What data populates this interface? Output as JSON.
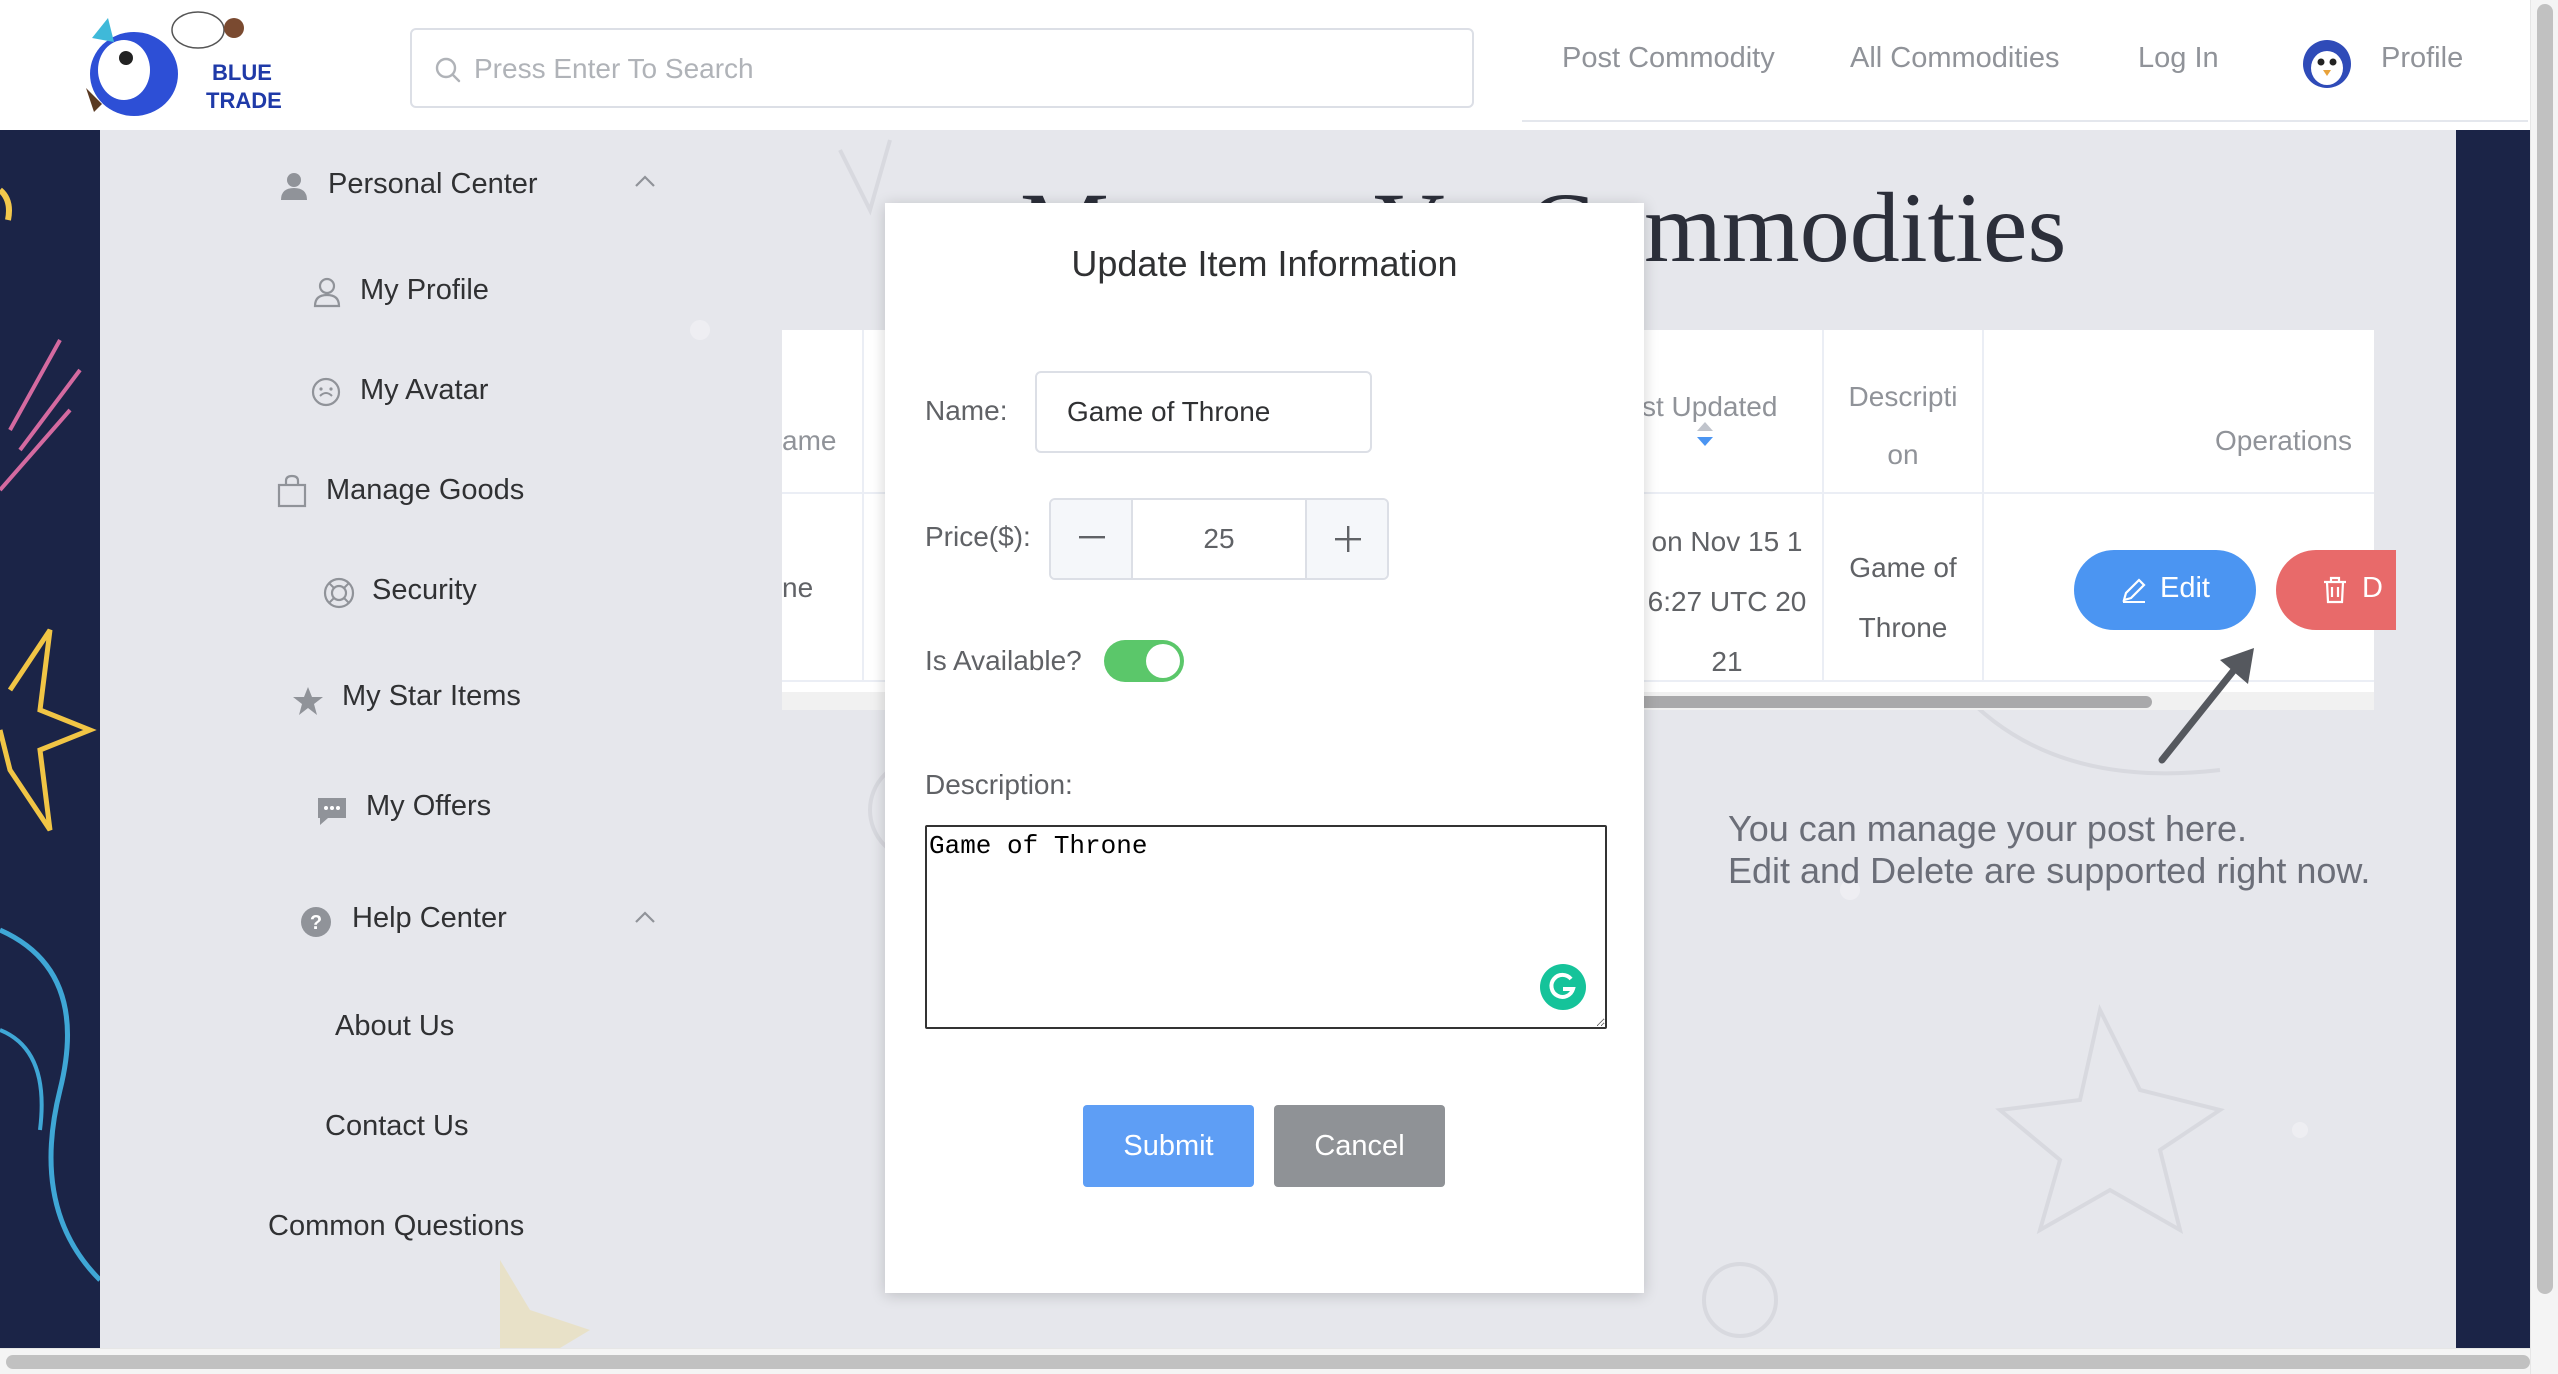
{
  "header": {
    "logo_text_line1": "BLUE",
    "logo_text_line2": "TRADE",
    "search_placeholder": "Press Enter To Search",
    "nav": {
      "post_commodity": "Post Commodity",
      "all_commodities": "All Commodities",
      "log_in": "Log In",
      "profile": "Profile"
    }
  },
  "sidebar": {
    "personal_center": "Personal Center",
    "my_profile": "My Profile",
    "my_avatar": "My Avatar",
    "manage_goods": "Manage Goods",
    "security": "Security",
    "my_star_items": "My Star Items",
    "my_offers": "My Offers",
    "help_center": "Help Center",
    "about_us": "About Us",
    "contact_us": "Contact Us",
    "common_questions": "Common Questions"
  },
  "page": {
    "title_partial_left": "M",
    "title_partial_mid": "Y",
    "title_visible": "Commodities"
  },
  "table": {
    "headers": {
      "name_partial": "ame",
      "last_updated_partial": "st Updated",
      "description_line1": "Descripti",
      "description_line2": "on",
      "operations": "Operations"
    },
    "row": {
      "name_partial": "ne",
      "date_line1": "on Nov 15 1",
      "date_line2": "6:27 UTC 20",
      "date_line3": "21",
      "description_line1": "Game of",
      "description_line2": "Throne"
    },
    "edit_button": "Edit",
    "delete_button_partial": "D"
  },
  "hint": {
    "line1": "You can manage your post here.",
    "line2": "Edit and Delete are supported right now."
  },
  "dialog": {
    "title": "Update Item Information",
    "name_label": "Name:",
    "name_value": "Game of Throne",
    "price_label": "Price($):",
    "price_value": "25",
    "available_label": "Is Available?",
    "is_available": true,
    "description_label": "Description:",
    "description_value": "Game of Throne",
    "submit": "Submit",
    "cancel": "Cancel"
  },
  "colors": {
    "accent_blue": "#4b95f2",
    "danger_red": "#e86a6a",
    "switch_green": "#5bc76a",
    "dark_bg": "#1b2447"
  }
}
